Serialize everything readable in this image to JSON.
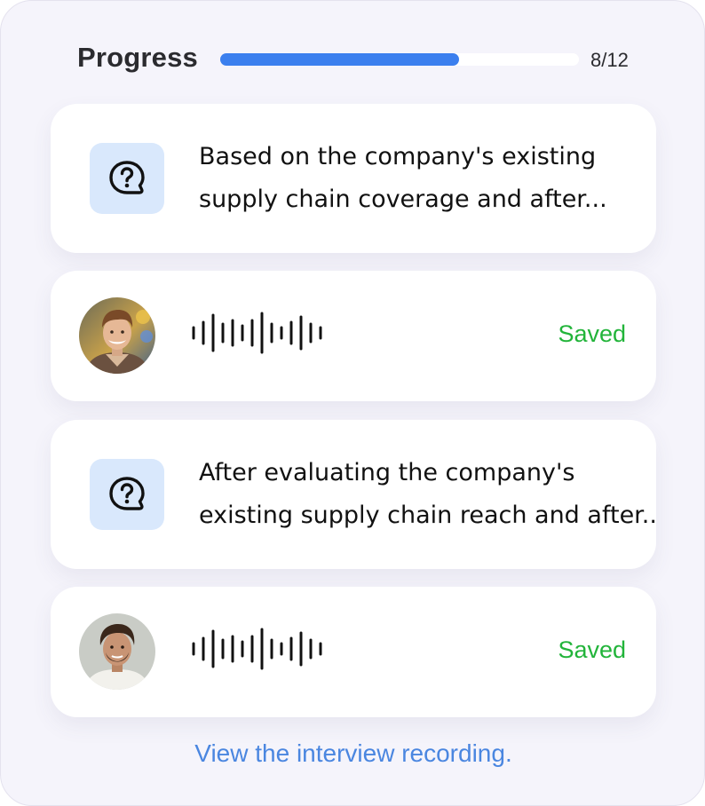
{
  "progress": {
    "title": "Progress",
    "count": "8/12",
    "value": 8,
    "total": 12
  },
  "colors": {
    "accent": "#3b7fee",
    "saved": "#22b43a",
    "link": "#4a86e0",
    "question_box": "#d9e8fc"
  },
  "items": [
    {
      "type": "question",
      "icon": "question-bubble-icon",
      "line1": "Based on the company's existing",
      "line2": "supply chain coverage and after..."
    },
    {
      "type": "answer",
      "avatar": "avatar",
      "icon": "audio-waveform-icon",
      "status": "Saved"
    },
    {
      "type": "question",
      "icon": "question-bubble-icon",
      "line1": "After evaluating the company's",
      "line2": "existing supply chain reach and after.."
    },
    {
      "type": "answer",
      "avatar": "avatar",
      "icon": "audio-waveform-icon",
      "status": "Saved"
    }
  ],
  "link": {
    "label": "View the interview recording."
  }
}
